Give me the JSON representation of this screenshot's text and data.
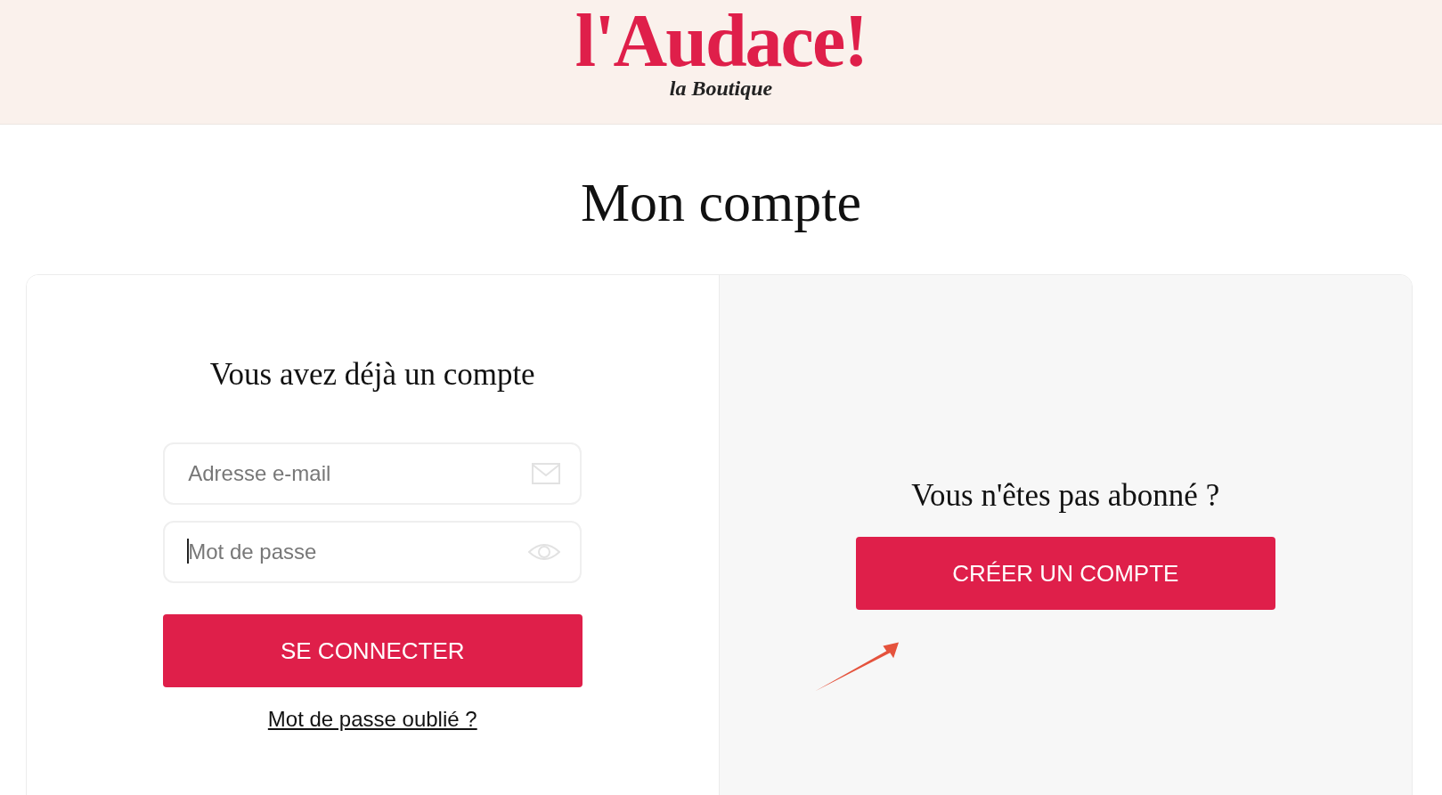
{
  "header": {
    "logo": "l'Audace!",
    "tagline": "la Boutique"
  },
  "page_title": "Mon compte",
  "login": {
    "heading": "Vous avez déjà un compte",
    "fields": [
      {
        "kind": "email",
        "placeholder": "Adresse e-mail",
        "focused": false
      },
      {
        "kind": "password",
        "placeholder": "Mot de passe",
        "focused": true
      }
    ],
    "button": "SE CONNECTER",
    "forgot_link": "Mot de passe oublié ?"
  },
  "signup": {
    "heading": "Vous n'êtes pas abonné ?",
    "button": "CRÉER UN COMPTE"
  }
}
